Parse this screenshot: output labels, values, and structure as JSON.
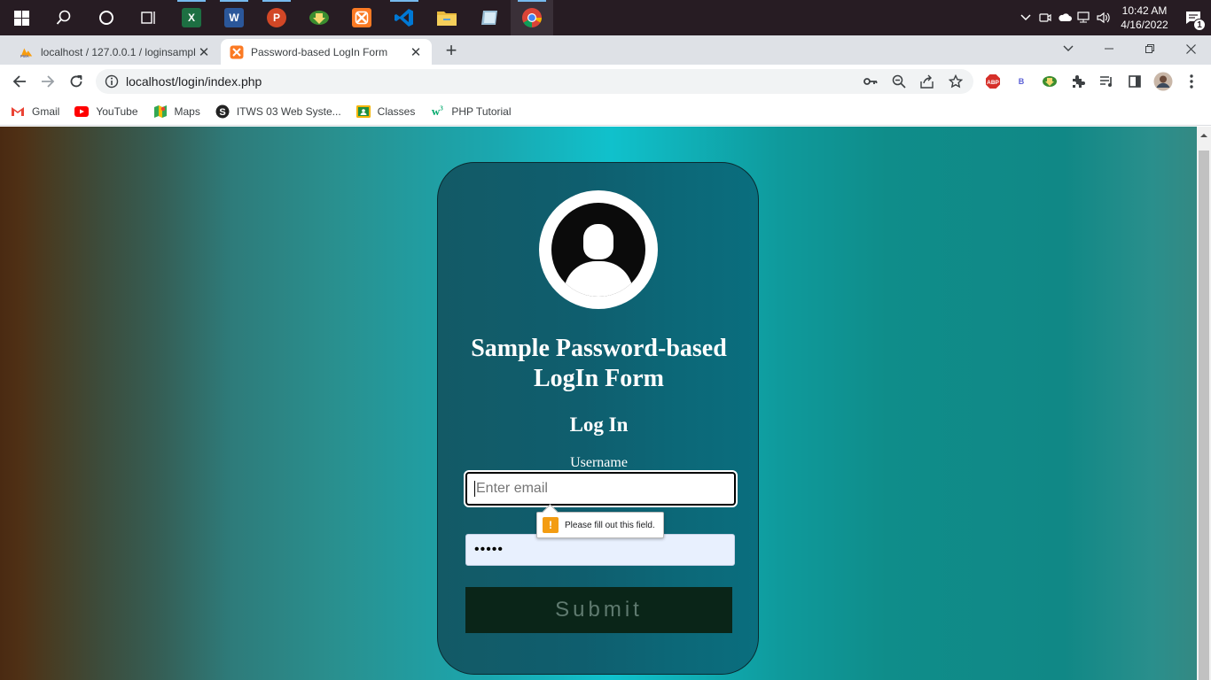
{
  "taskbar": {
    "apps": [
      {
        "name": "Excel",
        "glyph": "X",
        "color": "#1d6f42"
      },
      {
        "name": "Word",
        "glyph": "W",
        "color": "#2b579a"
      },
      {
        "name": "PowerPoint",
        "glyph": "P",
        "color": "#d24726"
      },
      {
        "name": "Internet Download Manager",
        "glyph": "",
        "color": "#3b8d2f"
      },
      {
        "name": "XAMPP",
        "glyph": "",
        "color": "#fb7a24"
      },
      {
        "name": "VS Code",
        "glyph": "",
        "color": "#0078d4"
      },
      {
        "name": "File Explorer",
        "glyph": "",
        "color": "#f0c419"
      },
      {
        "name": "App",
        "glyph": "",
        "color": "#9bbfd6"
      },
      {
        "name": "Chrome",
        "glyph": "",
        "color": "#db4437"
      }
    ],
    "time": "10:42 AM",
    "date": "4/16/2022",
    "notification_count": "1"
  },
  "tabs": [
    {
      "title": "localhost / 127.0.0.1 / loginsampl",
      "active": false
    },
    {
      "title": "Password-based LogIn Form",
      "active": true
    }
  ],
  "address_bar": {
    "url": "localhost/login/index.php"
  },
  "bookmarks": [
    {
      "label": "Gmail",
      "icon": "gmail-icon"
    },
    {
      "label": "YouTube",
      "icon": "youtube-icon"
    },
    {
      "label": "Maps",
      "icon": "maps-icon"
    },
    {
      "label": "ITWS 03 Web Syste...",
      "icon": "site-icon"
    },
    {
      "label": "Classes",
      "icon": "classroom-icon"
    },
    {
      "label": "PHP Tutorial",
      "icon": "w3schools-icon"
    }
  ],
  "form": {
    "title": "Sample Password-based LogIn Form",
    "subtitle": "Log In",
    "username_label": "Username",
    "email_placeholder": "Enter email",
    "password_value": "•••••",
    "submit_label": "Submit",
    "validation_message": "Please fill out this field."
  },
  "colors": {
    "card": "#0f5e6e",
    "submit_bg": "#0a2518",
    "tooltip_warning": "#f39c12"
  }
}
